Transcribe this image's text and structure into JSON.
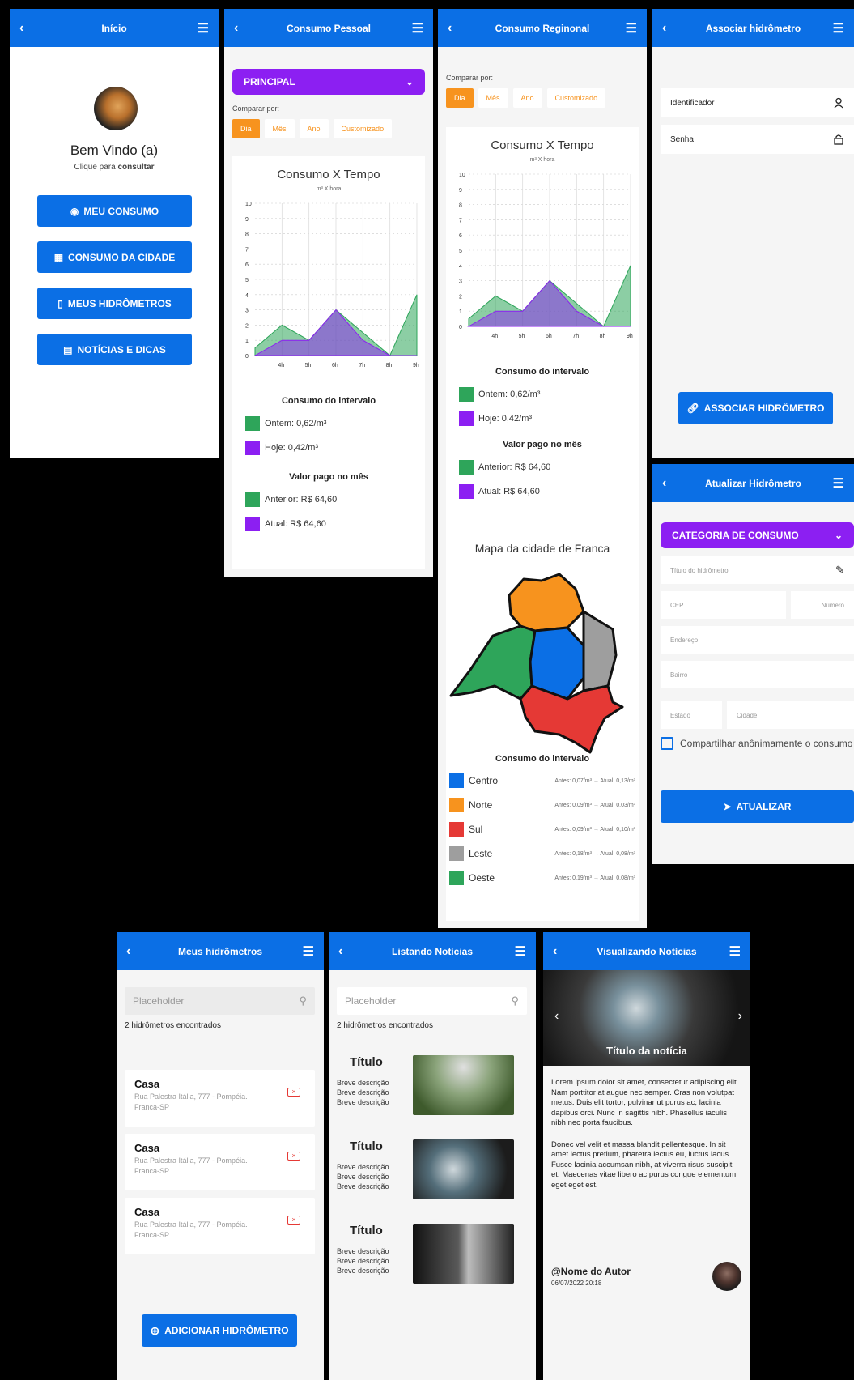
{
  "inicio": {
    "title": "Início",
    "welcome": "Bem Vindo (a)",
    "subtitle_prefix": "Clique para ",
    "subtitle_bold": "consultar",
    "buttons": [
      {
        "label": "MEU CONSUMO",
        "icon": "eye-icon"
      },
      {
        "label": "CONSUMO DA CIDADE",
        "icon": "map-icon"
      },
      {
        "label": "MEUS HIDRÔMETROS",
        "icon": "thermometer-icon"
      },
      {
        "label": "NOTÍCIAS E DICAS",
        "icon": "document-icon"
      }
    ]
  },
  "pessoal": {
    "title": "Consumo Pessoal",
    "select": "PRINCIPAL",
    "compare_label": "Comparar por:",
    "tabs": [
      "Dia",
      "Mês",
      "Ano",
      "Customizado"
    ],
    "chart_title": "Consumo X Tempo",
    "chart_sub": "m³ X hora",
    "interval_title": "Consumo do intervalo",
    "ontem": "Ontem: 0,62/m³",
    "hoje": "Hoje:   0,42/m³",
    "valor_title": "Valor pago no mês",
    "anterior": "Anterior: R$ 64,60",
    "atual": "Atual:     R$ 64,60"
  },
  "regional": {
    "title": "Consumo Reginonal",
    "compare_label": "Comparar por:",
    "tabs": [
      "Dia",
      "Mês",
      "Ano",
      "Customizado"
    ],
    "chart_title": "Consumo X Tempo",
    "chart_sub": "m³ X hora",
    "interval_title": "Consumo do intervalo",
    "ontem": "Ontem: 0,62/m³",
    "hoje": "Hoje:   0,42/m³",
    "valor_title": "Valor pago no mês",
    "anterior": "Anterior: R$ 64,60",
    "atual": "Atual:     R$ 64,60",
    "map_title": "Mapa da cidade de Franca",
    "regions_title": "Consumo do intervalo",
    "regions": [
      {
        "name": "Centro",
        "color": "#0b6fe5",
        "text": "Antes: 0,07/m³ → Atual: 0,13/m³"
      },
      {
        "name": "Norte",
        "color": "#f7931e",
        "text": "Antes: 0,09/m³ → Atual: 0,03/m³"
      },
      {
        "name": "Sul",
        "color": "#e53935",
        "text": "Antes: 0,09/m³ → Atual: 0,10/m³"
      },
      {
        "name": "Leste",
        "color": "#9e9e9e",
        "text": "Antes: 0,18/m³ → Atual: 0,08/m³"
      },
      {
        "name": "Oeste",
        "color": "#2ea55a",
        "text": "Antes: 0,19/m³ → Atual: 0,08/m³"
      }
    ]
  },
  "associar": {
    "title": "Associar hidrômetro",
    "id_label": "Identificador",
    "senha_label": "Senha",
    "button": "ASSOCIAR HIDRÔMETRO"
  },
  "atualizar": {
    "title": "Atualizar Hidrômetro",
    "select": "CATEGORIA DE CONSUMO",
    "titulo": "Título do hidrômetro",
    "cep": "CEP",
    "numero": "Número",
    "endereco": "Endereço",
    "bairro": "Bairro",
    "estado": "Estado",
    "cidade": "Cidade",
    "checkbox": "Compartilhar anônimamente o consumo",
    "button": "ATUALIZAR"
  },
  "meus": {
    "title": "Meus hidrômetros",
    "search": "Placeholder",
    "count": "2 hidrômetros encontrados",
    "items": [
      {
        "name": "Casa",
        "addr": "Rua Palestra Itália, 777 - Pompéia. Franca-SP"
      },
      {
        "name": "Casa",
        "addr": "Rua Palestra Itália, 777 - Pompéia. Franca-SP"
      },
      {
        "name": "Casa",
        "addr": "Rua Palestra Itália, 777 - Pompéia. Franca-SP"
      }
    ],
    "button": "ADICIONAR HIDRÔMETRO"
  },
  "listando": {
    "title": "Listando Notícias",
    "search": "Placeholder",
    "count": "2 hidrômetros encontrados",
    "items": [
      {
        "title": "Título",
        "desc": [
          "Breve descrição",
          "Breve descrição",
          "Breve descrição"
        ]
      },
      {
        "title": "Título",
        "desc": [
          "Breve descrição",
          "Breve descrição",
          "Breve descrição"
        ]
      },
      {
        "title": "Título",
        "desc": [
          "Breve descrição",
          "Breve descrição",
          "Breve descrição"
        ]
      }
    ]
  },
  "visualizando": {
    "title": "Visualizando Notícias",
    "headline": "Título da notícia",
    "p1": "Lorem ipsum dolor sit amet, consectetur adipiscing elit. Nam porttitor at augue nec semper. Cras non volutpat metus. Duis elit tortor, pulvinar ut purus ac, lacinia dapibus orci. Nunc in sagittis nibh. Phasellus iaculis nibh nec porta faucibus.",
    "p2": "Donec vel velit et massa blandit pellentesque. In sit amet lectus pretium, pharetra lectus eu, luctus lacus. Fusce lacinia accumsan nibh, at viverra risus suscipit et. Maecenas vitae libero ac purus congue elementum eget eget est.",
    "author": "@Nome do Autor",
    "date": "06/07/2022 20:18"
  },
  "chart_data": {
    "type": "area",
    "title": "Consumo X Tempo",
    "subtitle": "m³ X hora",
    "categories": [
      "4h",
      "5h",
      "6h",
      "7h",
      "8h",
      "9h"
    ],
    "ylim": [
      0,
      10
    ],
    "yticks": [
      0,
      1,
      2,
      3,
      4,
      5,
      6,
      7,
      8,
      9,
      10
    ],
    "series": [
      {
        "values": [
          0.5,
          2,
          1,
          3,
          1.5,
          0,
          4
        ],
        "color": "#2ea55a"
      },
      {
        "values": [
          0,
          1,
          1,
          3,
          1,
          0,
          0
        ],
        "color": "#8c1ff2"
      }
    ],
    "x_points": [
      "",
      "4h",
      "5h",
      "6h",
      "7h",
      "8h",
      "9h"
    ]
  }
}
